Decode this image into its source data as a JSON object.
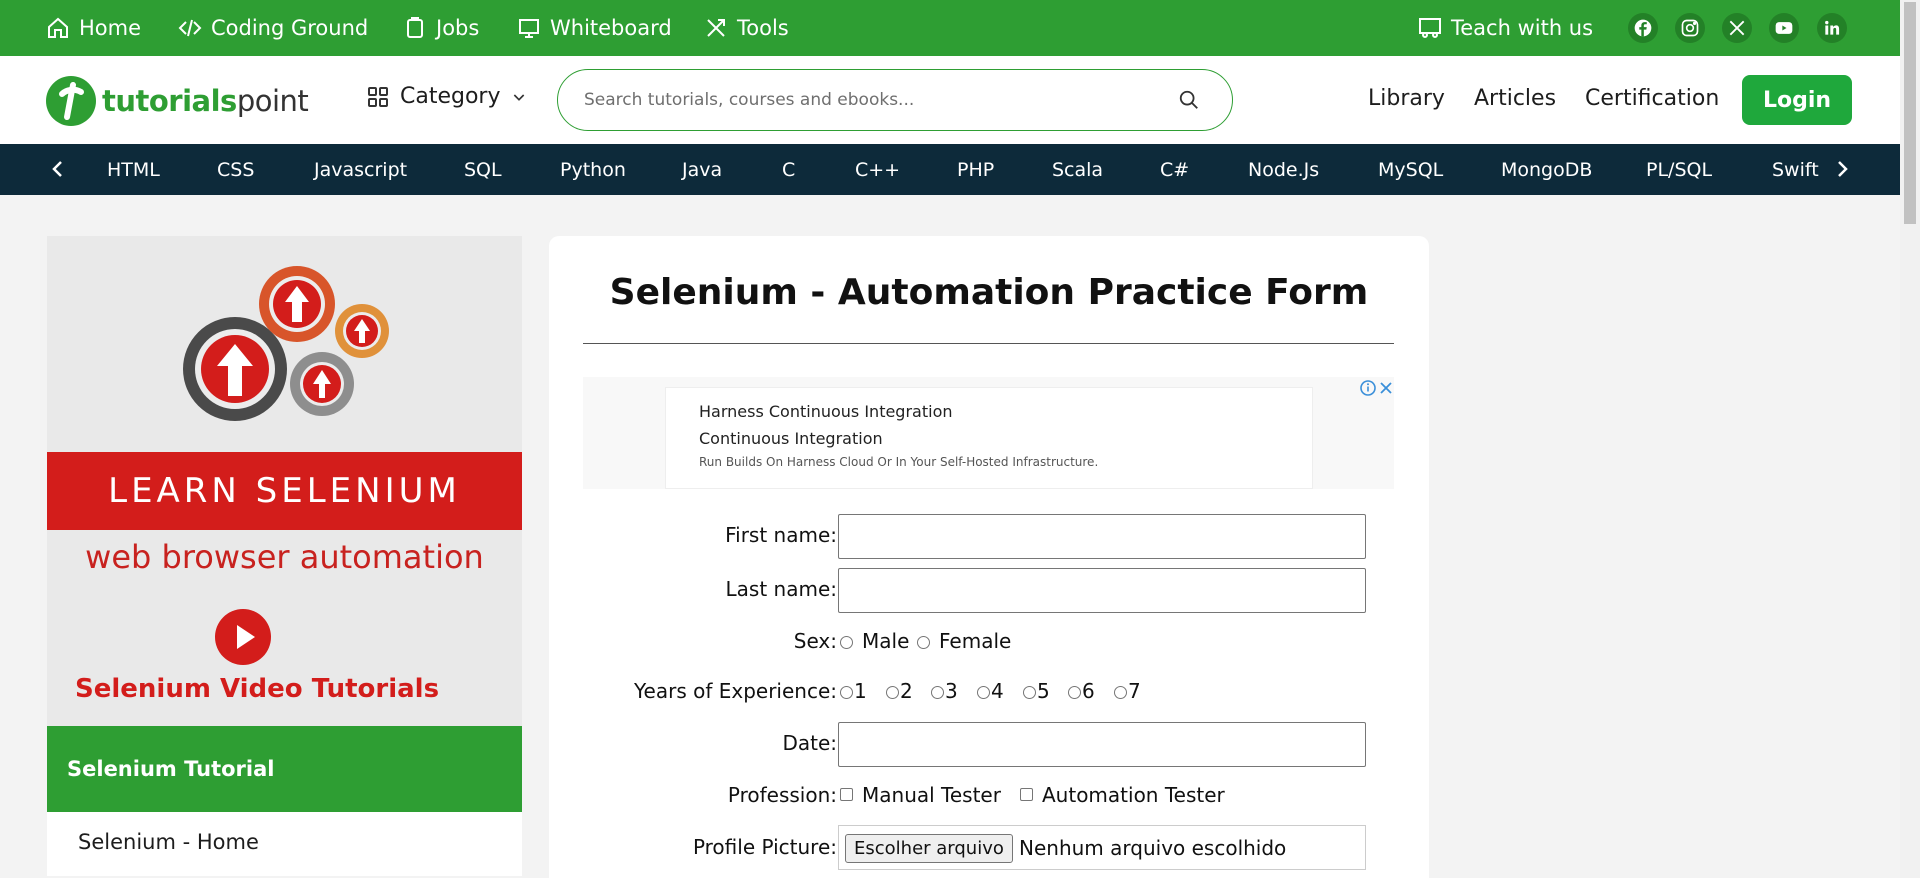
{
  "topbar": {
    "home": "Home",
    "coding_ground": "Coding Ground",
    "jobs": "Jobs",
    "whiteboard": "Whiteboard",
    "tools": "Tools",
    "teach": "Teach with us",
    "social_icons": [
      "facebook-icon",
      "instagram-icon",
      "x-icon",
      "youtube-icon",
      "linkedin-icon"
    ],
    "bg_color": "#2e9e33"
  },
  "header": {
    "logo_text_1": "tutorials",
    "logo_text_2": "point",
    "category": "Category",
    "search_placeholder": "Search tutorials, courses and ebooks...",
    "library": "Library",
    "articles": "Articles",
    "certification": "Certification",
    "login": "Login"
  },
  "tags": [
    "HTML",
    "CSS",
    "Javascript",
    "SQL",
    "Python",
    "Java",
    "C",
    "C++",
    "PHP",
    "Scala",
    "C#",
    "Node.Js",
    "MySQL",
    "MongoDB",
    "PL/SQL",
    "Swift"
  ],
  "sidebar": {
    "banner_title": "LEARN SELENIUM",
    "banner_sub": "web browser automation",
    "banner_video": "Selenium Video Tutorials",
    "heading": "Selenium Tutorial",
    "items": [
      "Selenium - Home"
    ]
  },
  "main": {
    "title": "Selenium - Automation Practice Form",
    "ad": {
      "line1": "Harness Continuous Integration",
      "line2": "Continuous Integration",
      "line3": "Run Builds On Harness Cloud Or In Your Self-Hosted Infrastructure."
    },
    "form": {
      "first_name": "First name:",
      "last_name": "Last name:",
      "sex": "Sex:",
      "male": "Male",
      "female": "Female",
      "experience": "Years of Experience:",
      "years": [
        "1",
        "2",
        "3",
        "4",
        "5",
        "6",
        "7"
      ],
      "date": "Date:",
      "profession": "Profession:",
      "manual": "Manual Tester",
      "automation": "Automation Tester",
      "profile": "Profile Picture:",
      "file_button": "Escolher arquivo",
      "file_status": "Nenhum arquivo escolhido"
    }
  }
}
